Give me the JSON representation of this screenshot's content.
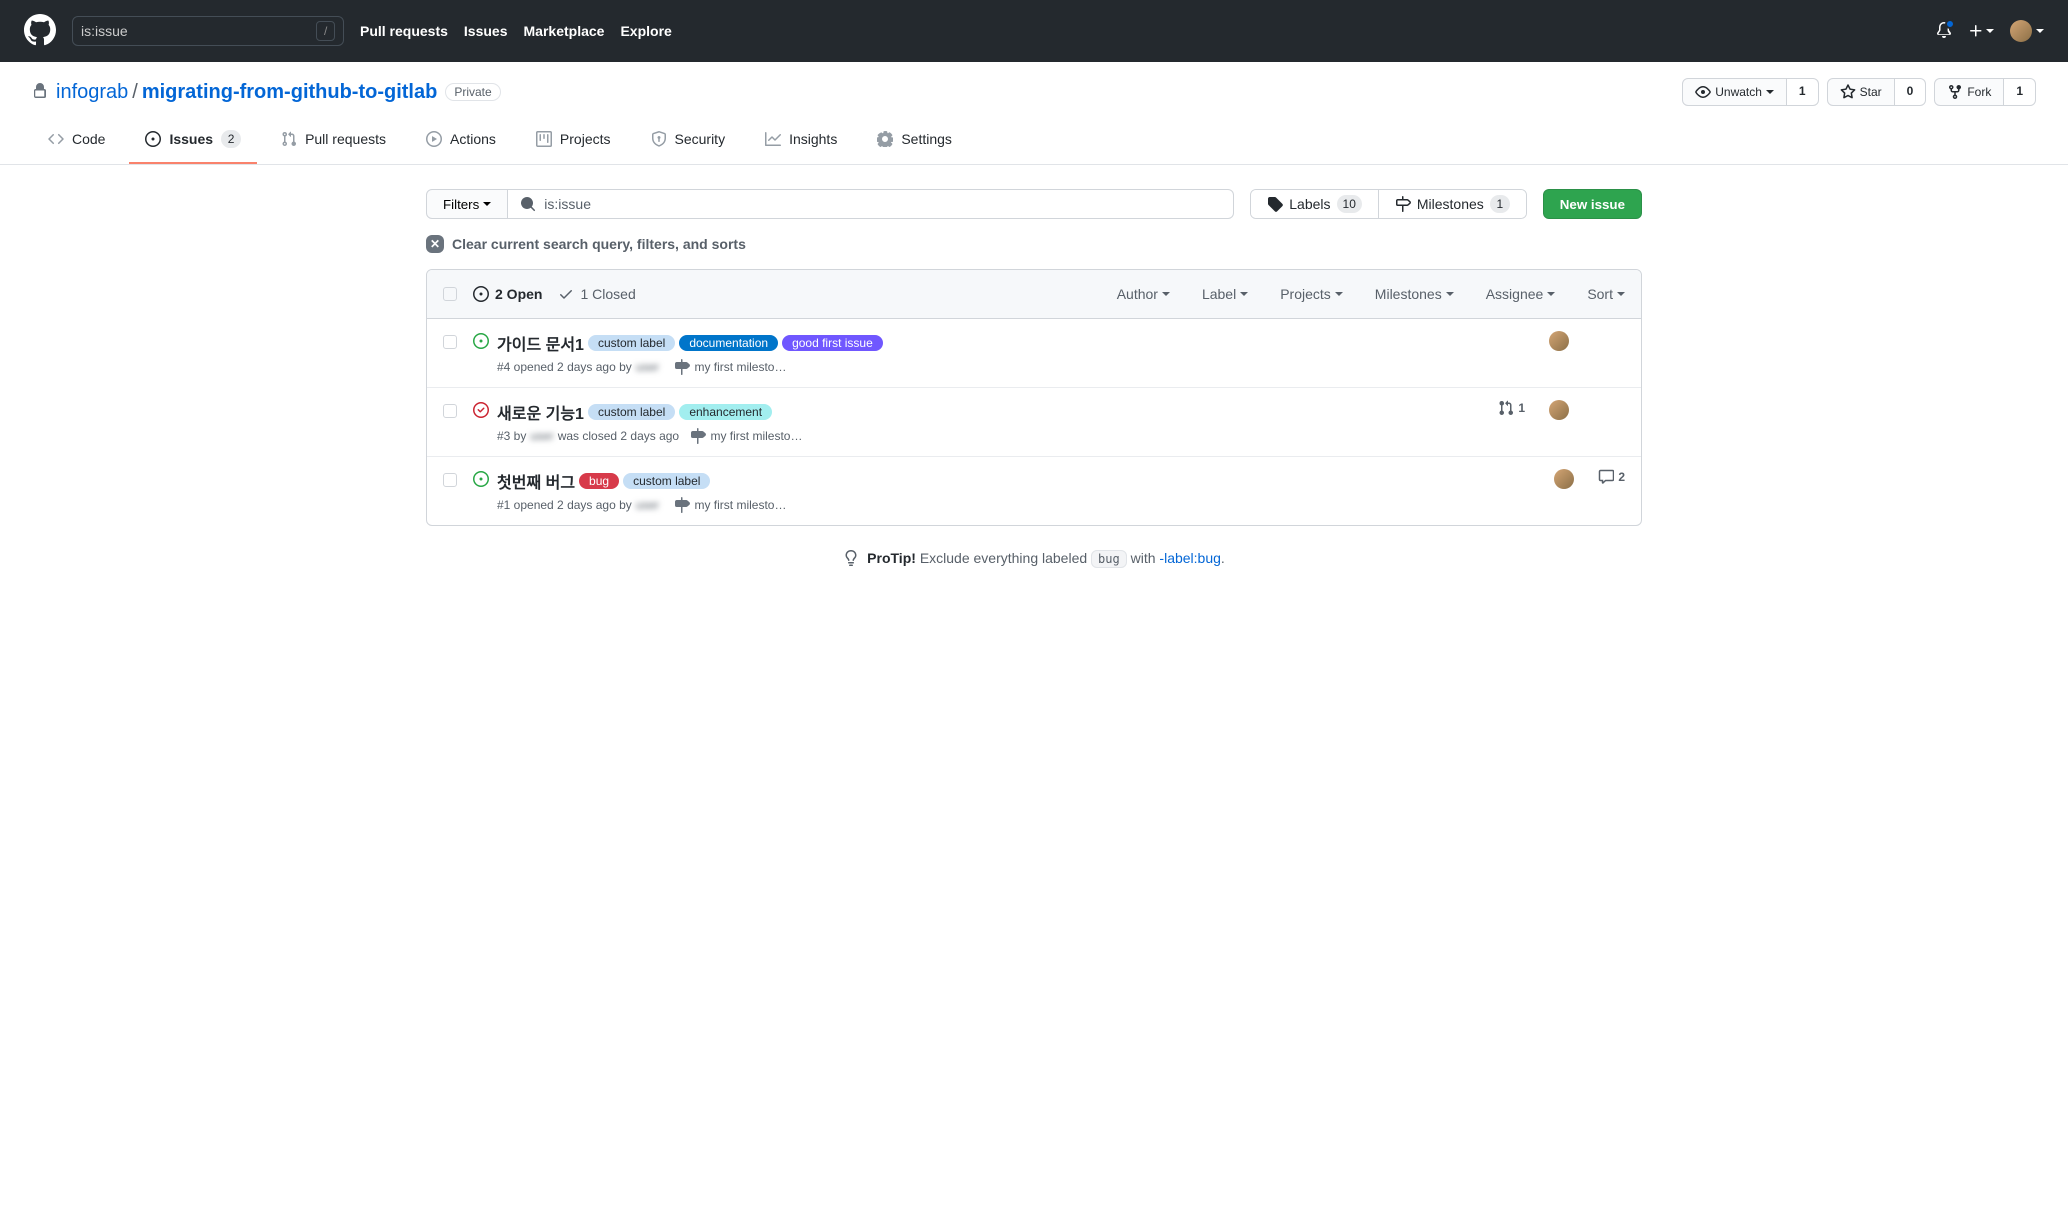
{
  "header": {
    "search_value": "is:issue",
    "slash": "/",
    "nav": [
      "Pull requests",
      "Issues",
      "Marketplace",
      "Explore"
    ]
  },
  "repo": {
    "owner": "infograb",
    "name": "migrating-from-github-to-gitlab",
    "visibility": "Private",
    "watch": {
      "label": "Unwatch",
      "count": "1"
    },
    "star": {
      "label": "Star",
      "count": "0"
    },
    "fork": {
      "label": "Fork",
      "count": "1"
    }
  },
  "tabs": {
    "code": "Code",
    "issues": "Issues",
    "issues_count": "2",
    "pulls": "Pull requests",
    "actions": "Actions",
    "projects": "Projects",
    "security": "Security",
    "insights": "Insights",
    "settings": "Settings"
  },
  "filters": {
    "button": "Filters",
    "query": "is:issue",
    "labels": "Labels",
    "labels_count": "10",
    "milestones": "Milestones",
    "milestones_count": "1",
    "new_issue": "New issue",
    "clear": "Clear current search query, filters, and sorts"
  },
  "list_head": {
    "open": "2 Open",
    "closed": "1 Closed",
    "author": "Author",
    "label": "Label",
    "projects": "Projects",
    "milestones": "Milestones",
    "assignee": "Assignee",
    "sort": "Sort"
  },
  "label_colors": {
    "custom_label": {
      "bg": "#c5def5",
      "fg": "#24292e"
    },
    "documentation": {
      "bg": "#0075ca",
      "fg": "#ffffff"
    },
    "good_first_issue": {
      "bg": "#7057ff",
      "fg": "#ffffff"
    },
    "enhancement": {
      "bg": "#a2eeef",
      "fg": "#24292e"
    },
    "bug": {
      "bg": "#d73a4a",
      "fg": "#ffffff"
    }
  },
  "issues": [
    {
      "state": "open",
      "title": "가이드 문서1",
      "labels": [
        {
          "text": "custom label",
          "color_key": "custom_label"
        },
        {
          "text": "documentation",
          "color_key": "documentation"
        },
        {
          "text": "good first issue",
          "color_key": "good_first_issue"
        }
      ],
      "meta_prefix": "#4 opened 2 days ago by ",
      "meta_author": "user",
      "milestone": "my first milesto…",
      "pr_count": null,
      "comments": null,
      "has_assignee": true
    },
    {
      "state": "closed",
      "title": "새로운 기능1",
      "labels": [
        {
          "text": "custom label",
          "color_key": "custom_label"
        },
        {
          "text": "enhancement",
          "color_key": "enhancement"
        }
      ],
      "meta_prefix": "#3 by ",
      "meta_author": "user",
      "meta_suffix": " was closed 2 days ago",
      "milestone": "my first milesto…",
      "pr_count": "1",
      "comments": null,
      "has_assignee": true
    },
    {
      "state": "open",
      "title": "첫번째 버그",
      "labels": [
        {
          "text": "bug",
          "color_key": "bug"
        },
        {
          "text": "custom label",
          "color_key": "custom_label"
        }
      ],
      "meta_prefix": "#1 opened 2 days ago by ",
      "meta_author": "user",
      "milestone": "my first milesto…",
      "pr_count": null,
      "comments": "2",
      "has_assignee": true
    }
  ],
  "protip": {
    "label": "ProTip!",
    "text1": "Exclude everything labeled ",
    "code": "bug",
    "text2": " with ",
    "link": "-label:bug",
    "dot": "."
  }
}
